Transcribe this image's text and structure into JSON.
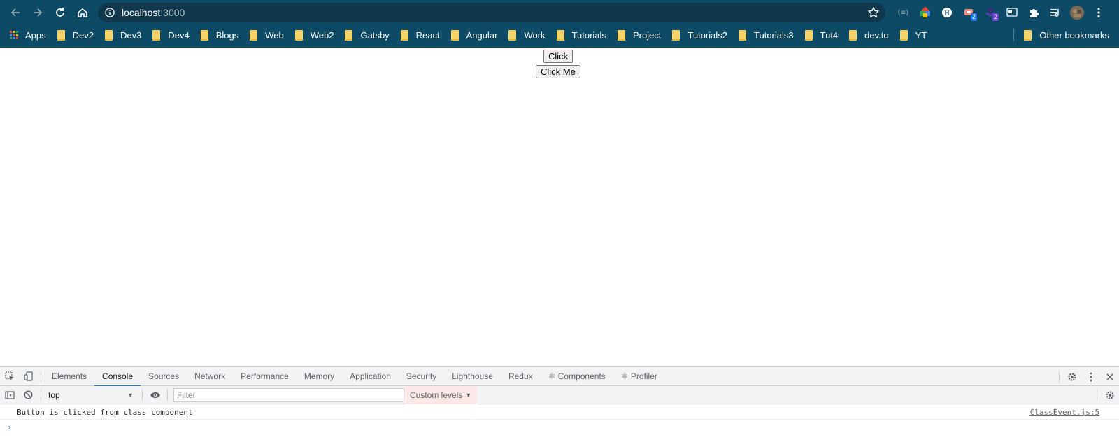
{
  "browser": {
    "url_host": "localhost",
    "url_port": ":3000",
    "icons": {
      "back": "arrow-left-icon",
      "forward": "arrow-right-icon",
      "reload": "reload-icon",
      "home": "home-icon",
      "info": "info-icon",
      "bookmark_star": "star-icon"
    },
    "extension_badges": [
      "2",
      "2"
    ]
  },
  "bookmarks": {
    "apps_label": "Apps",
    "items": [
      "Dev2",
      "Dev3",
      "Dev4",
      "Blogs",
      "Web",
      "Web2",
      "Gatsby",
      "React",
      "Angular",
      "Work",
      "Tutorials",
      "Project",
      "Tutorials2",
      "Tutorials3",
      "Tut4",
      "dev.to",
      "YT"
    ],
    "other_label": "Other bookmarks"
  },
  "page": {
    "button_click": "Click",
    "button_click_me": "Click Me"
  },
  "devtools": {
    "tabs": [
      "Elements",
      "Console",
      "Sources",
      "Network",
      "Performance",
      "Memory",
      "Application",
      "Security",
      "Lighthouse",
      "Redux",
      "⚛ Components",
      "⚛ Profiler"
    ],
    "active_tab": "Console",
    "context": "top",
    "filter_placeholder": "Filter",
    "levels_label": "Custom levels",
    "messages": [
      {
        "text": "Button is clicked from class component",
        "source": "ClassEvent.js:5"
      }
    ],
    "prompt": "›"
  },
  "colors": {
    "chrome_bg": "#0c4a66",
    "omnibox_bg": "#10384d",
    "devtools_accent": "#1a73e8"
  }
}
